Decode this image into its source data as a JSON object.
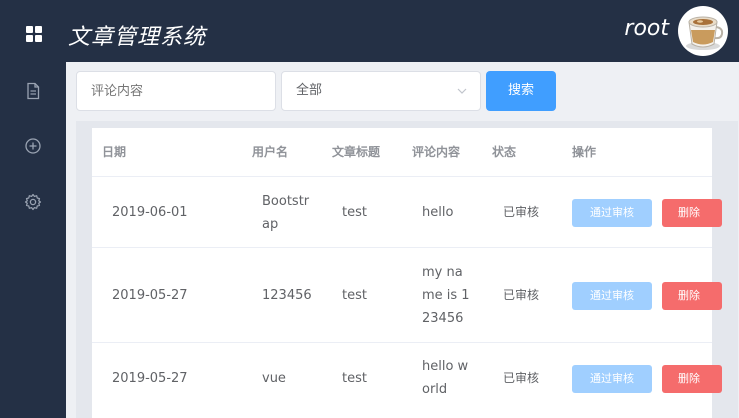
{
  "header": {
    "title": "文章管理系统",
    "username": "root"
  },
  "search": {
    "placeholder": "评论内容",
    "status_selected": "全部",
    "button_label": "搜索"
  },
  "table": {
    "columns": [
      "日期",
      "用户名",
      "文章标题",
      "评论内容",
      "状态",
      "操作"
    ],
    "rows": [
      {
        "date": "2019-06-01",
        "user": "Bootstrap",
        "title": "test",
        "comment": "hello",
        "status": "已审核",
        "approve": "通过审核",
        "delete": "删除"
      },
      {
        "date": "2019-05-27",
        "user": "123456",
        "title": "test",
        "comment": "my name is 123456",
        "status": "已审核",
        "approve": "通过审核",
        "delete": "删除"
      },
      {
        "date": "2019-05-27",
        "user": "vue",
        "title": "test",
        "comment": "hello world",
        "status": "已审核",
        "approve": "通过审核",
        "delete": "删除"
      }
    ]
  },
  "colors": {
    "nav_bg": "#243045",
    "primary": "#409eff",
    "approve_disabled": "#a0cfff",
    "danger": "#f56c6c"
  },
  "icons": {
    "menu": "grid-icon",
    "side": [
      "document-icon",
      "plus-circle-icon",
      "gear-icon"
    ]
  }
}
